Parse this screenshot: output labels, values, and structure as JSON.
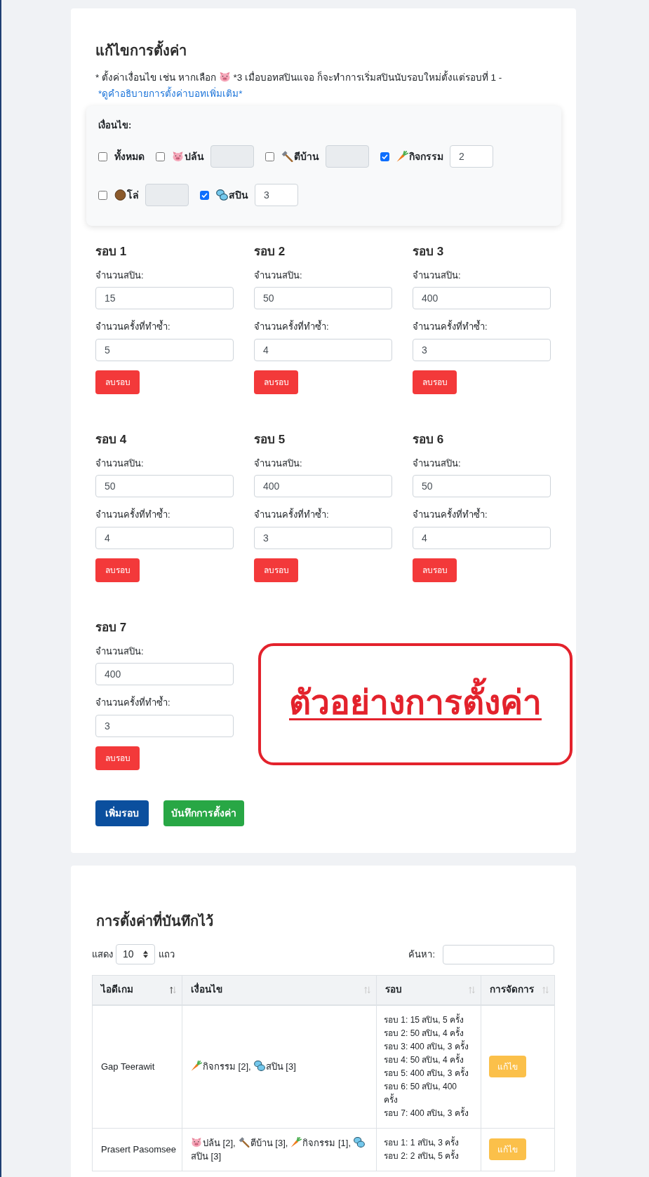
{
  "edit_settings": {
    "title": "แก้ไขการตั้งค่า",
    "note": [
      {
        "kind": "text",
        "text": "* ตั้งค่าเงื่อนไข เช่น หากเลือก"
      },
      {
        "kind": "pig"
      },
      {
        "kind": "text",
        "text": "*3 เมื่อบอทสปินแจอ ก็จะทำการเริ่มสปินนับรอบใหม่ตั้งแต่รอบที่ 1 -"
      },
      {
        "kind": "link",
        "text": "*ดูคำอธิบายการตั้งค่าบอทเพิ่มเติม*"
      }
    ],
    "conditions": {
      "label": "เงื่อนไข:",
      "items": [
        {
          "kind": "all",
          "label": "ทั้งหมด",
          "checked": false
        },
        {
          "kind": "pig",
          "label": "ปล้น",
          "checked": false
        },
        {
          "kind": "hammer",
          "label": "ตีบ้าน",
          "checked": false
        },
        {
          "kind": "carrot",
          "label": "กิจกรรม",
          "checked": true,
          "value": "2"
        },
        {
          "kind": "shield",
          "label": "โล่",
          "checked": false
        },
        {
          "kind": "spin",
          "label": "สปิน",
          "checked": true,
          "value": "3"
        }
      ]
    },
    "rounds": [
      {
        "title": "รอบ 1",
        "spins_label": "จำนวนสปิน:",
        "spins": "15",
        "repeat_label": "จำนวนครั้งที่ทำซ้ำ:",
        "repeat": "5",
        "delete_button": "ลบรอบ"
      },
      {
        "title": "รอบ 2",
        "spins_label": "จำนวนสปิน:",
        "spins": "50",
        "repeat_label": "จำนวนครั้งที่ทำซ้ำ:",
        "repeat": "4",
        "delete_button": "ลบรอบ"
      },
      {
        "title": "รอบ 3",
        "spins_label": "จำนวนสปิน:",
        "spins": "400",
        "repeat_label": "จำนวนครั้งที่ทำซ้ำ:",
        "repeat": "3",
        "delete_button": "ลบรอบ"
      },
      {
        "title": "รอบ 4",
        "spins_label": "จำนวนสปิน:",
        "spins": "50",
        "repeat_label": "จำนวนครั้งที่ทำซ้ำ:",
        "repeat": "4",
        "delete_button": "ลบรอบ"
      },
      {
        "title": "รอบ 5",
        "spins_label": "จำนวนสปิน:",
        "spins": "400",
        "repeat_label": "จำนวนครั้งที่ทำซ้ำ:",
        "repeat": "3",
        "delete_button": "ลบรอบ"
      },
      {
        "title": "รอบ 6",
        "spins_label": "จำนวนสปิน:",
        "spins": "50",
        "repeat_label": "จำนวนครั้งที่ทำซ้ำ:",
        "repeat": "4",
        "delete_button": "ลบรอบ"
      },
      {
        "title": "รอบ 7",
        "spins_label": "จำนวนสปิน:",
        "spins": "400",
        "repeat_label": "จำนวนครั้งที่ทำซ้ำ:",
        "repeat": "3",
        "delete_button": "ลบรอบ"
      }
    ],
    "annotation": {
      "text": "ตัวอย่างการตั้งค่า"
    },
    "buttons": [
      {
        "kind": "primary",
        "label": "เพิ่มรอบ"
      },
      {
        "kind": "success",
        "label": "บันทึกการตั้งค่า"
      }
    ]
  },
  "saved_settings": {
    "title": "การตั้งค่าที่บันทึกไว้",
    "page_length": {
      "before": "แสดง",
      "value": "10",
      "after": "แถว"
    },
    "search": {
      "label": "ค้นหา:"
    },
    "table": {
      "columns": [
        {
          "label": "ไอดีเกม",
          "sorted": true
        },
        {
          "label": "เงื่อนไข",
          "sorted": false
        },
        {
          "label": "รอบ",
          "sorted": false
        },
        {
          "label": "การจัดการ",
          "sorted": false
        }
      ],
      "rows": [
        {
          "game_id": "Gap Teerawit",
          "conditions": [
            {
              "kind": "carrot",
              "text": "กิจกรรม [2],"
            },
            {
              "kind": "spin",
              "text": "สปิน [3]"
            }
          ],
          "rounds": [
            "รอบ 1: 15 สปิน, 5 ครั้ง",
            "รอบ 2: 50 สปิน, 4 ครั้ง",
            "รอบ 3: 400 สปิน, 3 ครั้ง",
            "รอบ 4: 50 สปิน, 4 ครั้ง",
            "รอบ 5: 400 สปิน, 3 ครั้ง",
            "รอบ 6: 50 สปิน, 400 ครั้ง",
            "รอบ 7: 400 สปิน, 3 ครั้ง"
          ],
          "action": "แก้ไข"
        },
        {
          "game_id": "Prasert Pasomsee",
          "conditions": [
            {
              "kind": "pig",
              "text": "ปล้น [2],"
            },
            {
              "kind": "hammer",
              "text": "ตีบ้าน [3],"
            },
            {
              "kind": "carrot",
              "text": "กิจกรรม [1],"
            },
            {
              "kind": "spin",
              "text": "สปิน [3]"
            }
          ],
          "rounds": [
            "รอบ 1: 1 สปิน, 3 ครั้ง",
            "รอบ 2: 2 สปิน, 5 ครั้ง"
          ],
          "action": "แก้ไข"
        }
      ]
    }
  }
}
